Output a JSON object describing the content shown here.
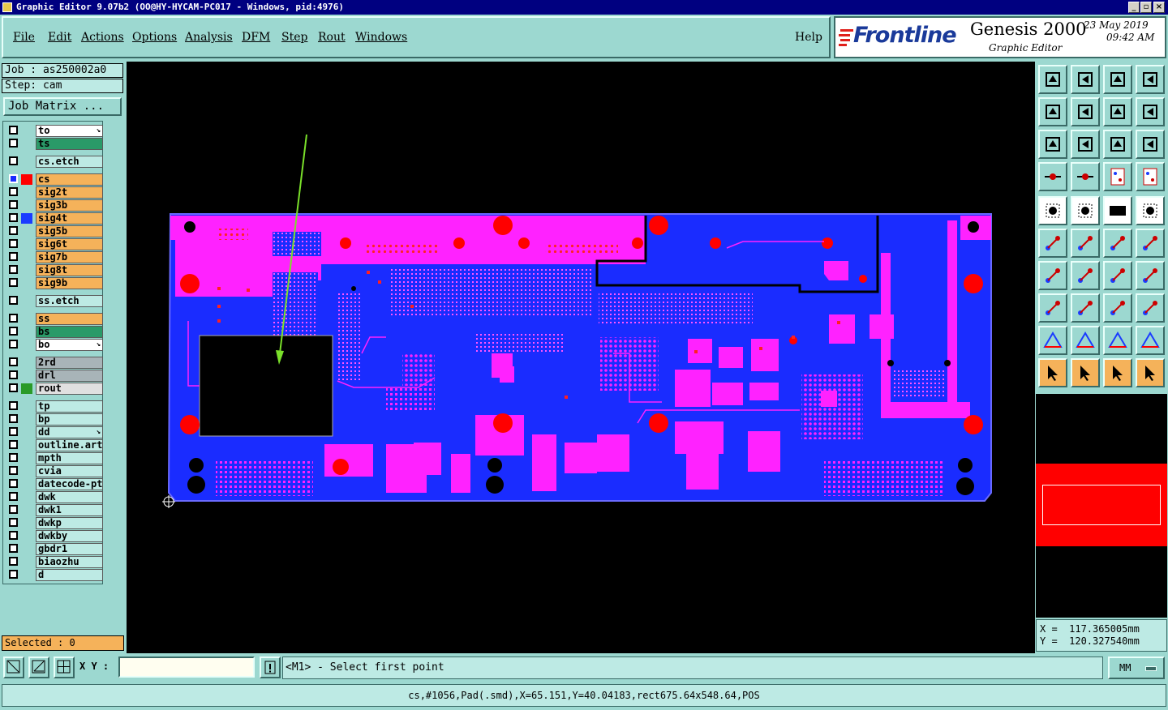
{
  "window": {
    "title": "Graphic Editor 9.07b2 (OO@HY-HYCAM-PC017 - Windows, pid:4976)"
  },
  "menu": {
    "file": "File",
    "edit": "Edit",
    "actions": "Actions",
    "options": "Options",
    "analysis": "Analysis",
    "dfm": "DFM",
    "step": "Step",
    "rout": "Rout",
    "windows": "Windows",
    "help": "Help"
  },
  "branding": {
    "logo": "Frontline",
    "product": "Genesis 2000",
    "subtitle": "Graphic Editor",
    "date": "23 May 2019",
    "time": "09:42 AM"
  },
  "job": {
    "job_label": "Job : as250002a0",
    "step_label": "Step: cam",
    "matrix_button": "Job Matrix ..."
  },
  "layers": [
    {
      "name": "to",
      "color": "#ffffff",
      "arrow": true
    },
    {
      "name": "ts",
      "color": "#2a9a68"
    },
    {
      "name": "cs.etch",
      "color": "#bdeae4"
    },
    {
      "name": "cs",
      "color": "#f5b25a",
      "work": true,
      "marker": "#ff0000"
    },
    {
      "name": "sig2t",
      "color": "#f5b25a"
    },
    {
      "name": "sig3b",
      "color": "#f5b25a"
    },
    {
      "name": "sig4t",
      "color": "#f5b25a",
      "marker": "#1a3cff"
    },
    {
      "name": "sig5b",
      "color": "#f5b25a"
    },
    {
      "name": "sig6t",
      "color": "#f5b25a"
    },
    {
      "name": "sig7b",
      "color": "#f5b25a"
    },
    {
      "name": "sig8t",
      "color": "#f5b25a"
    },
    {
      "name": "sig9b",
      "color": "#f5b25a"
    },
    {
      "name": "ss.etch",
      "color": "#bdeae4"
    },
    {
      "name": "ss",
      "color": "#f5b25a"
    },
    {
      "name": "bs",
      "color": "#2a9a68"
    },
    {
      "name": "bo",
      "color": "#ffffff",
      "arrow": true
    },
    {
      "name": "2rd",
      "color": "#a8b4b8"
    },
    {
      "name": "drl",
      "color": "#a8b4b8"
    },
    {
      "name": "rout",
      "color": "#e0e0e0",
      "marker": "#2a9a28"
    },
    {
      "name": "tp",
      "color": "#bdeae4"
    },
    {
      "name": "bp",
      "color": "#bdeae4"
    },
    {
      "name": "dd",
      "color": "#bdeae4",
      "arrow": true
    },
    {
      "name": "outline.art",
      "color": "#bdeae4"
    },
    {
      "name": "mpth",
      "color": "#bdeae4"
    },
    {
      "name": "cvia",
      "color": "#bdeae4"
    },
    {
      "name": "datecode-pto",
      "color": "#bdeae4"
    },
    {
      "name": "dwk",
      "color": "#bdeae4"
    },
    {
      "name": "dwk1",
      "color": "#bdeae4"
    },
    {
      "name": "dwkp",
      "color": "#bdeae4"
    },
    {
      "name": "dwkby",
      "color": "#bdeae4"
    },
    {
      "name": "gbdr1",
      "color": "#bdeae4"
    },
    {
      "name": "biaozhu",
      "color": "#bdeae4"
    },
    {
      "name": "d",
      "color": "#bdeae4"
    }
  ],
  "selection": {
    "text": "Selected : 0"
  },
  "cursor": {
    "x_text": "X =  117.365005mm",
    "y_text": "Y =  120.327540mm"
  },
  "command": {
    "xy_label": "X Y :",
    "xy_value": "",
    "prompt": "<M1> - Select first point",
    "units": "MM"
  },
  "status": {
    "text": "cs,#1056,Pad(.smd),X=65.151,Y=40.04183,rect675.64x548.64,POS"
  },
  "colors": {
    "board": "#1a2cff",
    "copper": "#ff22ff",
    "pad": "#ff0000",
    "background": "#000000",
    "panel": "#9cd8d0"
  }
}
